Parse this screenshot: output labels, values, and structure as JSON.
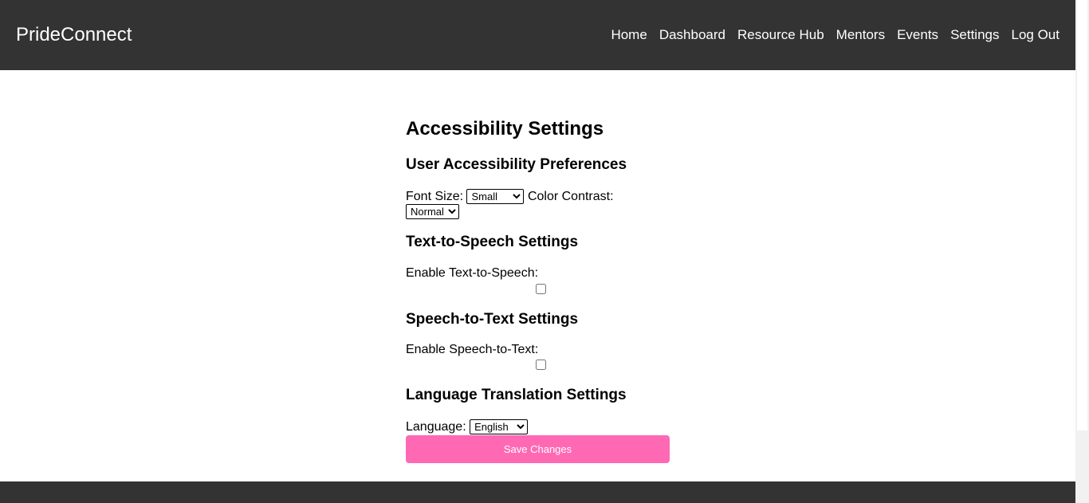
{
  "header": {
    "brand": "PrideConnect",
    "nav": [
      "Home",
      "Dashboard",
      "Resource Hub",
      "Mentors",
      "Events",
      "Settings",
      "Log Out"
    ]
  },
  "main": {
    "title": "Accessibility Settings",
    "user_prefs": {
      "heading": "User Accessibility Preferences",
      "font_size_label": "Font Size:",
      "font_size_value": "Small",
      "contrast_label": "Color Contrast:",
      "contrast_value": "Normal"
    },
    "tts": {
      "heading": "Text-to-Speech Settings",
      "label": "Enable Text-to-Speech:",
      "checked": false
    },
    "stt": {
      "heading": "Speech-to-Text Settings",
      "label": "Enable Speech-to-Text:",
      "checked": false
    },
    "language": {
      "heading": "Language Translation Settings",
      "label": "Language:",
      "value": "English"
    },
    "save_label": "Save Changes"
  },
  "colors": {
    "header_bg": "#333333",
    "accent": "#ff69b4"
  }
}
